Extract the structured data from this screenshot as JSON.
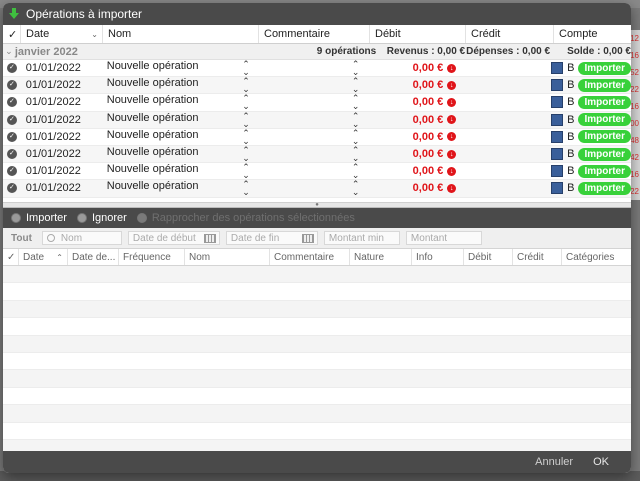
{
  "window": {
    "title": "Opérations à importer"
  },
  "background": {
    "right_values": [
      "12",
      "16",
      "52",
      "22",
      "16",
      "00",
      "48",
      "42",
      "16",
      "22"
    ]
  },
  "top_table": {
    "columns": {
      "check": "✓",
      "date": "Date",
      "name": "Nom",
      "comment": "Commentaire",
      "debit": "Débit",
      "credit": "Crédit",
      "account": "Compte"
    },
    "group": {
      "title": "janvier 2022",
      "count": "9 opérations",
      "revenus": "Revenus : 0,00 €",
      "depenses": "Dépenses : 0,00 €",
      "solde": "Solde : 0,00 €"
    },
    "rows": [
      {
        "date": "01/01/2022",
        "name": "Nouvelle opération",
        "debit": "0,00 €",
        "account_letter": "B",
        "action": "Importer"
      },
      {
        "date": "01/01/2022",
        "name": "Nouvelle opération",
        "debit": "0,00 €",
        "account_letter": "B",
        "action": "Importer"
      },
      {
        "date": "01/01/2022",
        "name": "Nouvelle opération",
        "debit": "0,00 €",
        "account_letter": "B",
        "action": "Importer"
      },
      {
        "date": "01/01/2022",
        "name": "Nouvelle opération",
        "debit": "0,00 €",
        "account_letter": "B",
        "action": "Importer"
      },
      {
        "date": "01/01/2022",
        "name": "Nouvelle opération",
        "debit": "0,00 €",
        "account_letter": "B",
        "action": "Importer"
      },
      {
        "date": "01/01/2022",
        "name": "Nouvelle opération",
        "debit": "0,00 €",
        "account_letter": "B",
        "action": "Importer"
      },
      {
        "date": "01/01/2022",
        "name": "Nouvelle opération",
        "debit": "0,00 €",
        "account_letter": "B",
        "action": "Importer"
      },
      {
        "date": "01/01/2022",
        "name": "Nouvelle opération",
        "debit": "0,00 €",
        "account_letter": "B",
        "action": "Importer"
      }
    ]
  },
  "radio_bar": {
    "import": "Importer",
    "ignore": "Ignorer",
    "reconcile": "Rapprocher des opérations sélectionnées"
  },
  "filter_bar": {
    "all": "Tout",
    "name_placeholder": "Nom",
    "start_date_placeholder": "Date de début",
    "end_date_placeholder": "Date de fin",
    "min_amount_placeholder": "Montant min",
    "amount_placeholder": "Montant"
  },
  "bottom_table": {
    "columns": {
      "check": "✓",
      "date": "Date",
      "date_end": "Date de...",
      "frequency": "Fréquence",
      "name": "Nom",
      "comment": "Commentaire",
      "nature": "Nature",
      "info": "Info",
      "debit": "Débit",
      "credit": "Crédit",
      "categories": "Catégories"
    }
  },
  "footer": {
    "cancel": "Annuler",
    "ok": "OK"
  },
  "colors": {
    "debit_red": "#e0151a",
    "import_green": "#38d13a",
    "dark_bar": "#4a4a4a"
  }
}
